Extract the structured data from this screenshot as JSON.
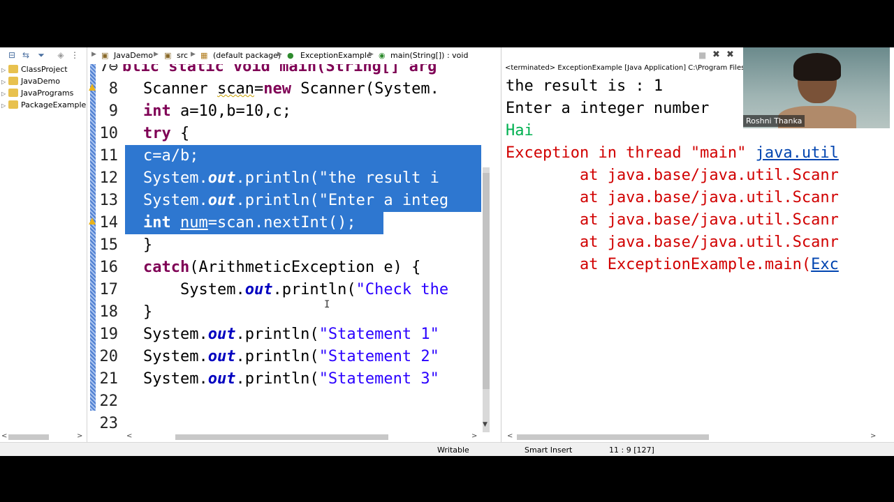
{
  "package_explorer": {
    "items": [
      "ClassProject",
      "JavaDemo",
      "JavaPrograms",
      "PackageExample"
    ]
  },
  "breadcrumb": [
    "JavaDemo",
    "src",
    "(default package)",
    "ExceptionExample",
    "main(String[]) : void"
  ],
  "editor": {
    "line7_partial": "blic static void main(String[] arg",
    "lines": [
      {
        "num": "8"
      },
      {
        "num": "9"
      },
      {
        "num": "10"
      },
      {
        "num": "11"
      },
      {
        "num": "12"
      },
      {
        "num": "13"
      },
      {
        "num": "14"
      },
      {
        "num": "15"
      },
      {
        "num": "16"
      },
      {
        "num": "17"
      },
      {
        "num": "18"
      },
      {
        "num": "19"
      },
      {
        "num": "20"
      },
      {
        "num": "21"
      },
      {
        "num": "22"
      },
      {
        "num": "23"
      }
    ],
    "line_num_7": "7⊖",
    "code": {
      "l8a": "Scanner ",
      "l8b": "scan",
      "l8c": "=",
      "l8d": "new",
      "l8e": " Scanner(System.",
      "l9a": "int",
      "l9b": " a=10,b=10,c;",
      "l10a": "try",
      "l10b": " {",
      "l11": "c=a/b;",
      "l12a": "System.",
      "l12b": "out",
      "l12c": ".println(",
      "l12d": "\"the result i",
      "l13a": "System.",
      "l13b": "out",
      "l13c": ".println(",
      "l13d": "\"Enter a integ",
      "l14a": "int",
      "l14b": " ",
      "l14c": "num",
      "l14d": "=scan.nextInt();",
      "l15": "}",
      "l16a": "catch",
      "l16b": "(ArithmeticException e) {",
      "l17a": "    System.",
      "l17b": "out",
      "l17c": ".println(",
      "l17d": "\"Check the",
      "l18": "}",
      "l19a": "System.",
      "l19b": "out",
      "l19c": ".println(",
      "l19d": "\"Statement 1\"",
      "l20a": "System.",
      "l20b": "out",
      "l20c": ".println(",
      "l20d": "\"Statement 2\"",
      "l21a": "System.",
      "l21b": "out",
      "l21c": ".println(",
      "l21d": "\"Statement 3\""
    }
  },
  "console": {
    "title": "<terminated> ExceptionExample [Java Application] C:\\Program Files\\",
    "lines": [
      {
        "text": "the result is : 1",
        "kind": "ok"
      },
      {
        "text": "Enter a integer number",
        "kind": "ok"
      },
      {
        "text": "Hai",
        "kind": "green"
      },
      {
        "text": "Exception in thread \"main\" ",
        "kind": "err",
        "link": "java.util"
      },
      {
        "text": "        at java.base/java.util.Scanr",
        "kind": "err"
      },
      {
        "text": "        at java.base/java.util.Scanr",
        "kind": "err"
      },
      {
        "text": "        at java.base/java.util.Scanr",
        "kind": "err"
      },
      {
        "text": "        at java.base/java.util.Scanr",
        "kind": "err"
      },
      {
        "text": "        at ExceptionExample.main(",
        "kind": "err",
        "link": "Exc"
      }
    ]
  },
  "status": {
    "writable": "Writable",
    "insert_mode": "Smart Insert",
    "position": "11 : 9 [127]"
  },
  "webcam": {
    "name": "Roshni Thanka"
  },
  "colors": {
    "selection": "#2e77d0",
    "keyword": "#7f0055",
    "field": "#0000c0",
    "string": "#2a00ff",
    "error": "#d10000",
    "hai": "#00b050"
  }
}
